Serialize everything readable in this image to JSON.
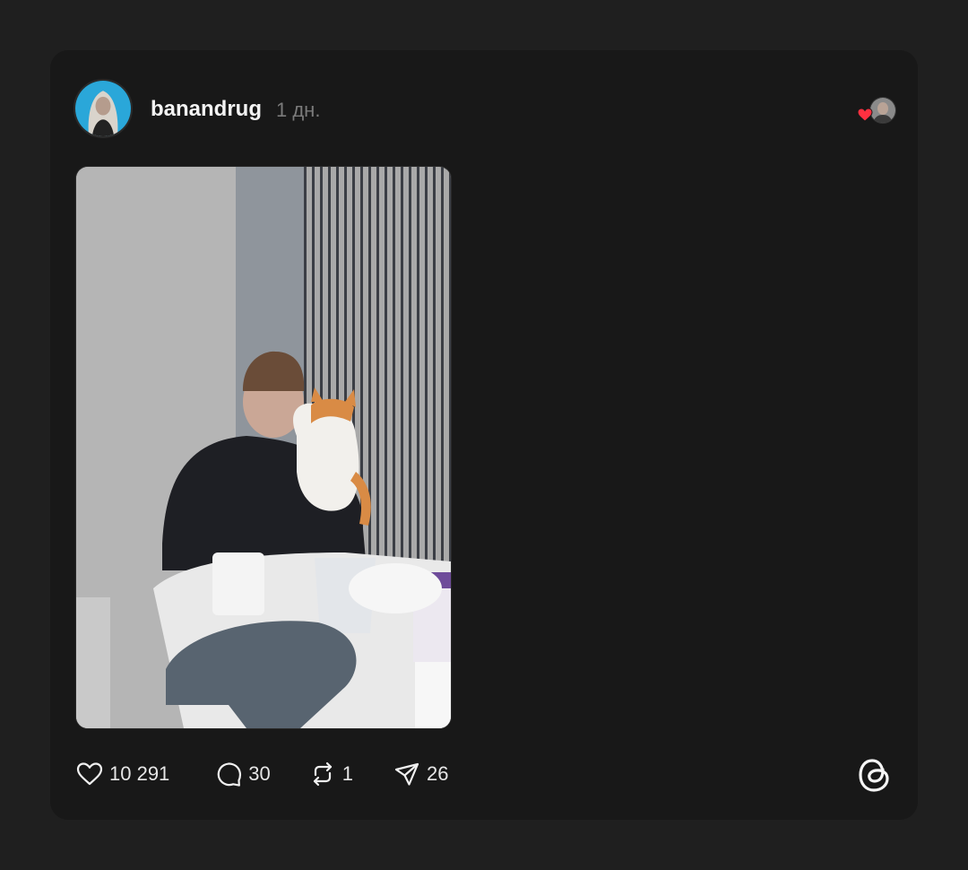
{
  "post": {
    "author": "banandrug",
    "time_ago": "1 дн.",
    "liked_by_icon": "heart-icon",
    "photo_description_icon": "photo",
    "stats": {
      "likes": "10 291",
      "comments": "30",
      "reposts": "1",
      "shares": "26"
    }
  },
  "icons": {
    "like": "heart-outline-icon",
    "comment": "comment-bubble-icon",
    "repost": "repost-icon",
    "share": "send-icon",
    "brand": "threads-logo-icon"
  },
  "colors": {
    "background": "#1f1f1f",
    "card": "#181818",
    "accent_heart": "#ff3040",
    "text_muted": "#7b7b7b"
  }
}
